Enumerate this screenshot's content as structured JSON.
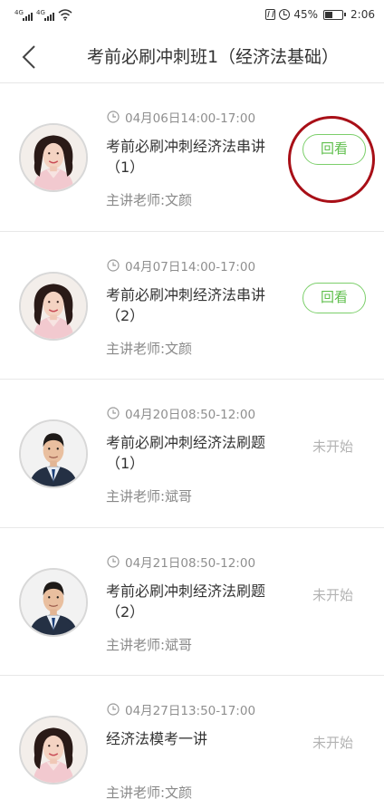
{
  "status_bar": {
    "signal_tag": "4G",
    "battery": "45%",
    "battery_level": 0.45,
    "time": "2:06"
  },
  "nav": {
    "title": "考前必刷冲刺班1（经济法基础）"
  },
  "colors": {
    "accent_green": "#5fbf4c",
    "annotation_red": "#a80f17"
  },
  "lessons": [
    {
      "time": "04月06日14:00-17:00",
      "title": "考前必刷冲刺经济法串讲（1）",
      "teacher": "主讲老师:文颜",
      "action": "回看",
      "action_type": "replay",
      "avatar": "female"
    },
    {
      "time": "04月07日14:00-17:00",
      "title": "考前必刷冲刺经济法串讲（2）",
      "teacher": "主讲老师:文颜",
      "action": "回看",
      "action_type": "replay",
      "avatar": "female"
    },
    {
      "time": "04月20日08:50-12:00",
      "title": "考前必刷冲刺经济法刷题（1）",
      "teacher": "主讲老师:斌哥",
      "action": "未开始",
      "action_type": "pending",
      "avatar": "male"
    },
    {
      "time": "04月21日08:50-12:00",
      "title": "考前必刷冲刺经济法刷题（2）",
      "teacher": "主讲老师:斌哥",
      "action": "未开始",
      "action_type": "pending",
      "avatar": "male"
    },
    {
      "time": "04月27日13:50-17:00",
      "title": "经济法模考一讲",
      "teacher": "主讲老师:文颜",
      "action": "未开始",
      "action_type": "pending",
      "avatar": "female"
    }
  ]
}
